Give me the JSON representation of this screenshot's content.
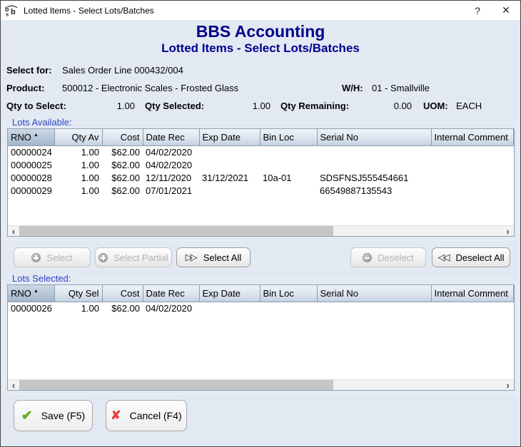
{
  "window": {
    "title": "Lotted Items - Select Lots/Batches",
    "help_label": "?",
    "close_label": "✕"
  },
  "header": {
    "app_title": "BBS Accounting",
    "subtitle": "Lotted Items - Select Lots/Batches"
  },
  "info": {
    "select_for_label": "Select for:",
    "select_for_value": "Sales Order Line 000432/004",
    "product_label": "Product:",
    "product_value": "500012 - Electronic Scales - Frosted Glass",
    "wh_label": "W/H:",
    "wh_value": "01 - Smallville",
    "qty_to_select_label": "Qty to Select:",
    "qty_to_select_value": "1.00",
    "qty_selected_label": "Qty Selected:",
    "qty_selected_value": "1.00",
    "qty_remaining_label": "Qty Remaining:",
    "qty_remaining_value": "0.00",
    "uom_label": "UOM:",
    "uom_value": "EACH"
  },
  "lots_available": {
    "group_label": "Lots Available:",
    "columns": [
      "RNO",
      "Qty Av",
      "Cost",
      "Date Rec",
      "Exp Date",
      "Bin Loc",
      "Serial No",
      "Internal Comment"
    ],
    "sort_col": 0,
    "sort_indicator": "▲",
    "rows": [
      [
        "00000024",
        "1.00",
        "$62.00",
        "04/02/2020",
        "",
        "",
        "",
        ""
      ],
      [
        "00000025",
        "1.00",
        "$62.00",
        "04/02/2020",
        "",
        "",
        "",
        ""
      ],
      [
        "00000028",
        "1.00",
        "$62.00",
        "12/11/2020",
        "31/12/2021",
        "10a-01",
        "SDSFNSJ555454661",
        ""
      ],
      [
        "00000029",
        "1.00",
        "$62.00",
        "07/01/2021",
        "",
        "",
        "66549887135543",
        ""
      ]
    ]
  },
  "lots_selected": {
    "group_label": "Lots Selected:",
    "columns": [
      "RNO",
      "Qty Sel",
      "Cost",
      "Date Rec",
      "Exp Date",
      "Bin Loc",
      "Serial No",
      "Internal Comment"
    ],
    "sort_col": 0,
    "sort_indicator": "▲",
    "rows": [
      [
        "00000026",
        "1.00",
        "$62.00",
        "04/02/2020",
        "",
        "",
        "",
        ""
      ]
    ]
  },
  "actions": {
    "select_label": "Select",
    "select_partial_label": "Select Partial",
    "select_all_label": "Select All",
    "deselect_label": "Deselect",
    "deselect_all_label": "Deselect All",
    "select_all_icon": "▷▷",
    "deselect_all_icon": "◁◁"
  },
  "scrollbar": {
    "left_arrow": "‹",
    "right_arrow": "›"
  },
  "footer": {
    "save_label": "Save (F5)",
    "cancel_label": "Cancel (F4)",
    "save_icon": "✔",
    "cancel_icon": "✘"
  },
  "colors": {
    "brand_navy": "#00008B",
    "group_label_blue": "#3244c4",
    "save_green": "#5fae1e",
    "cancel_red": "#e34040"
  }
}
